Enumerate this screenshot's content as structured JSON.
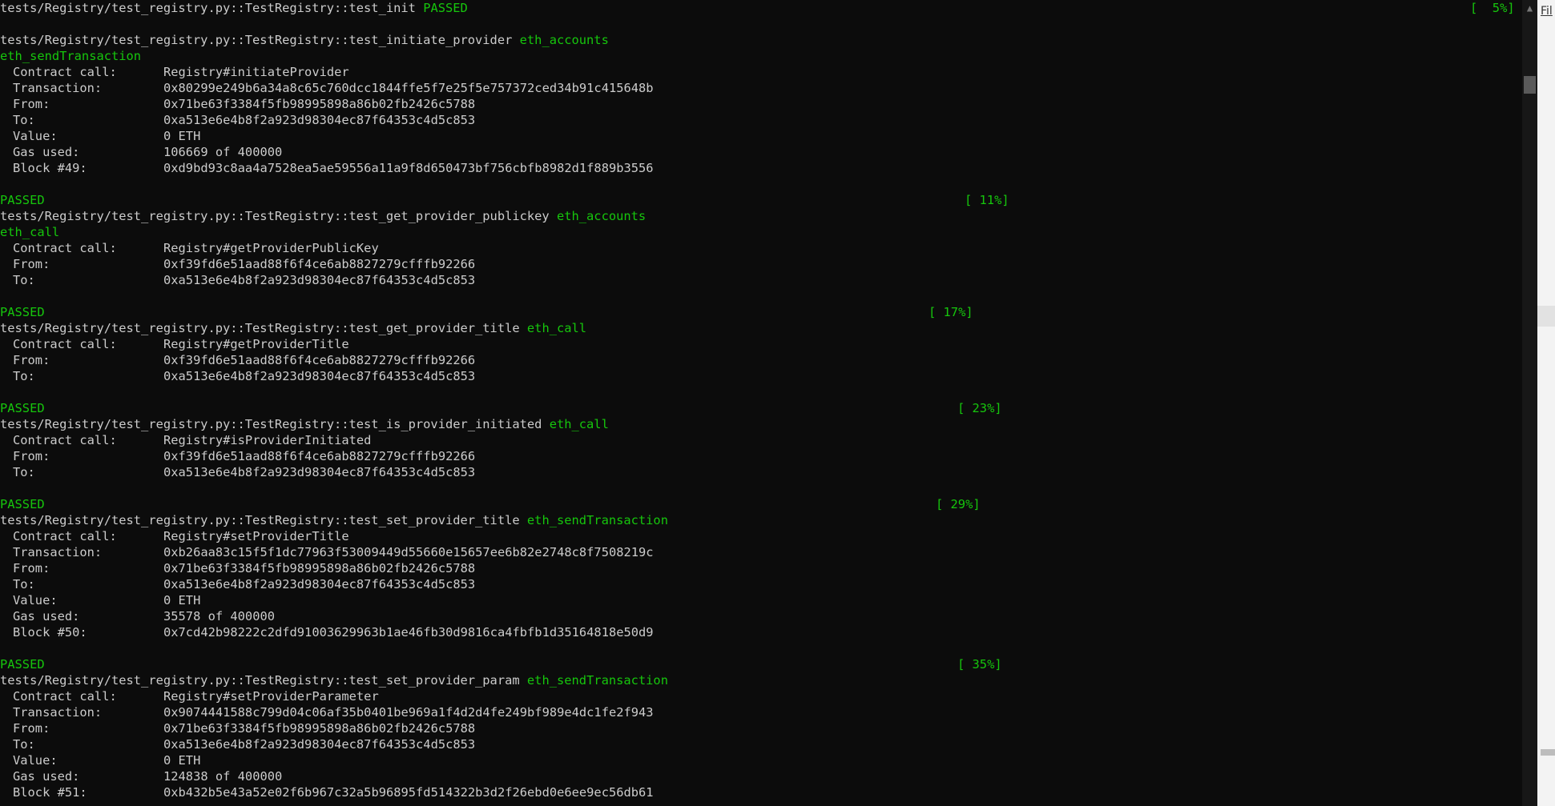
{
  "terminal": {
    "lines": [
      {
        "type": "test",
        "text": "tests/Registry/test_registry.py::TestRegistry::test_init",
        "tags": [],
        "status": "PASSED",
        "pct": "[  5%]",
        "pct_x": 1835
      },
      {
        "type": "blank"
      },
      {
        "type": "test",
        "text": "tests/Registry/test_registry.py::TestRegistry::test_initiate_provider",
        "tags": [
          "eth_accounts"
        ]
      },
      {
        "type": "green",
        "text": "eth_sendTransaction"
      },
      {
        "type": "field",
        "label": "Contract call:",
        "value": "Registry#initiateProvider"
      },
      {
        "type": "field",
        "label": "Transaction:",
        "value": "0x80299e249b6a34a8c65c760dcc1844ffe5f7e25f5e757372ced34b91c415648b"
      },
      {
        "type": "field",
        "label": "From:",
        "value": "0x71be63f3384f5fb98995898a86b02fb2426c5788"
      },
      {
        "type": "field",
        "label": "To:",
        "value": "0xa513e6e4b8f2a923d98304ec87f64353c4d5c853"
      },
      {
        "type": "field",
        "label": "Value:",
        "value": "0 ETH"
      },
      {
        "type": "field",
        "label": "Gas used:",
        "value": "106669 of 400000"
      },
      {
        "type": "field",
        "label": "Block #49:",
        "value": "0xd9bd93c8aa4a7528ea5ae59556a11a9f8d650473bf756cbfb8982d1f889b3556"
      },
      {
        "type": "blank"
      },
      {
        "type": "passed",
        "text": "PASSED",
        "pct": "[ 11%]",
        "pct_x": 1204
      },
      {
        "type": "test",
        "text": "tests/Registry/test_registry.py::TestRegistry::test_get_provider_publickey",
        "tags": [
          "eth_accounts"
        ]
      },
      {
        "type": "green",
        "text": "eth_call"
      },
      {
        "type": "field",
        "label": "Contract call:",
        "value": "Registry#getProviderPublicKey"
      },
      {
        "type": "field",
        "label": "From:",
        "value": "0xf39fd6e51aad88f6f4ce6ab8827279cfffb92266"
      },
      {
        "type": "field",
        "label": "To:",
        "value": "0xa513e6e4b8f2a923d98304ec87f64353c4d5c853"
      },
      {
        "type": "blank"
      },
      {
        "type": "passed",
        "text": "PASSED",
        "pct": "[ 17%]",
        "pct_x": 1159
      },
      {
        "type": "test",
        "text": "tests/Registry/test_registry.py::TestRegistry::test_get_provider_title",
        "tags": [
          "eth_call"
        ]
      },
      {
        "type": "field",
        "label": "Contract call:",
        "value": "Registry#getProviderTitle"
      },
      {
        "type": "field",
        "label": "From:",
        "value": "0xf39fd6e51aad88f6f4ce6ab8827279cfffb92266"
      },
      {
        "type": "field",
        "label": "To:",
        "value": "0xa513e6e4b8f2a923d98304ec87f64353c4d5c853"
      },
      {
        "type": "blank"
      },
      {
        "type": "passed",
        "text": "PASSED",
        "pct": "[ 23%]",
        "pct_x": 1195
      },
      {
        "type": "test",
        "text": "tests/Registry/test_registry.py::TestRegistry::test_is_provider_initiated",
        "tags": [
          "eth_call"
        ]
      },
      {
        "type": "field",
        "label": "Contract call:",
        "value": "Registry#isProviderInitiated"
      },
      {
        "type": "field",
        "label": "From:",
        "value": "0xf39fd6e51aad88f6f4ce6ab8827279cfffb92266"
      },
      {
        "type": "field",
        "label": "To:",
        "value": "0xa513e6e4b8f2a923d98304ec87f64353c4d5c853"
      },
      {
        "type": "blank"
      },
      {
        "type": "passed",
        "text": "PASSED",
        "pct": "[ 29%]",
        "pct_x": 1168
      },
      {
        "type": "test",
        "text": "tests/Registry/test_registry.py::TestRegistry::test_set_provider_title",
        "tags": [
          "eth_sendTransaction"
        ]
      },
      {
        "type": "field",
        "label": "Contract call:",
        "value": "Registry#setProviderTitle"
      },
      {
        "type": "field",
        "label": "Transaction:",
        "value": "0xb26aa83c15f5f1dc77963f53009449d55660e15657ee6b82e2748c8f7508219c"
      },
      {
        "type": "field",
        "label": "From:",
        "value": "0x71be63f3384f5fb98995898a86b02fb2426c5788"
      },
      {
        "type": "field",
        "label": "To:",
        "value": "0xa513e6e4b8f2a923d98304ec87f64353c4d5c853"
      },
      {
        "type": "field",
        "label": "Value:",
        "value": "0 ETH"
      },
      {
        "type": "field",
        "label": "Gas used:",
        "value": "35578 of 400000"
      },
      {
        "type": "field",
        "label": "Block #50:",
        "value": "0x7cd42b98222c2dfd91003629963b1ae46fb30d9816ca4fbfb1d35164818e50d9"
      },
      {
        "type": "blank"
      },
      {
        "type": "passed",
        "text": "PASSED",
        "pct": "[ 35%]",
        "pct_x": 1195
      },
      {
        "type": "test",
        "text": "tests/Registry/test_registry.py::TestRegistry::test_set_provider_param",
        "tags": [
          "eth_sendTransaction"
        ]
      },
      {
        "type": "field",
        "label": "Contract call:",
        "value": "Registry#setProviderParameter"
      },
      {
        "type": "field",
        "label": "Transaction:",
        "value": "0x9074441588c799d04c06af35b0401be969a1f4d2d4fe249bf989e4dc1fe2f943"
      },
      {
        "type": "field",
        "label": "From:",
        "value": "0x71be63f3384f5fb98995898a86b02fb2426c5788"
      },
      {
        "type": "field",
        "label": "To:",
        "value": "0xa513e6e4b8f2a923d98304ec87f64353c4d5c853"
      },
      {
        "type": "field",
        "label": "Value:",
        "value": "0 ETH"
      },
      {
        "type": "field",
        "label": "Gas used:",
        "value": "124838 of 400000"
      },
      {
        "type": "field",
        "label": "Block #51:",
        "value": "0xb432b5e43a52e02f6b967c32a5b96895fd514322b3d2f26ebd0e6ee9ec56db61"
      }
    ]
  },
  "side_panel": {
    "label": "Fil"
  },
  "colors": {
    "background": "#0c0c0c",
    "text": "#cccccc",
    "green": "#16c60c"
  }
}
